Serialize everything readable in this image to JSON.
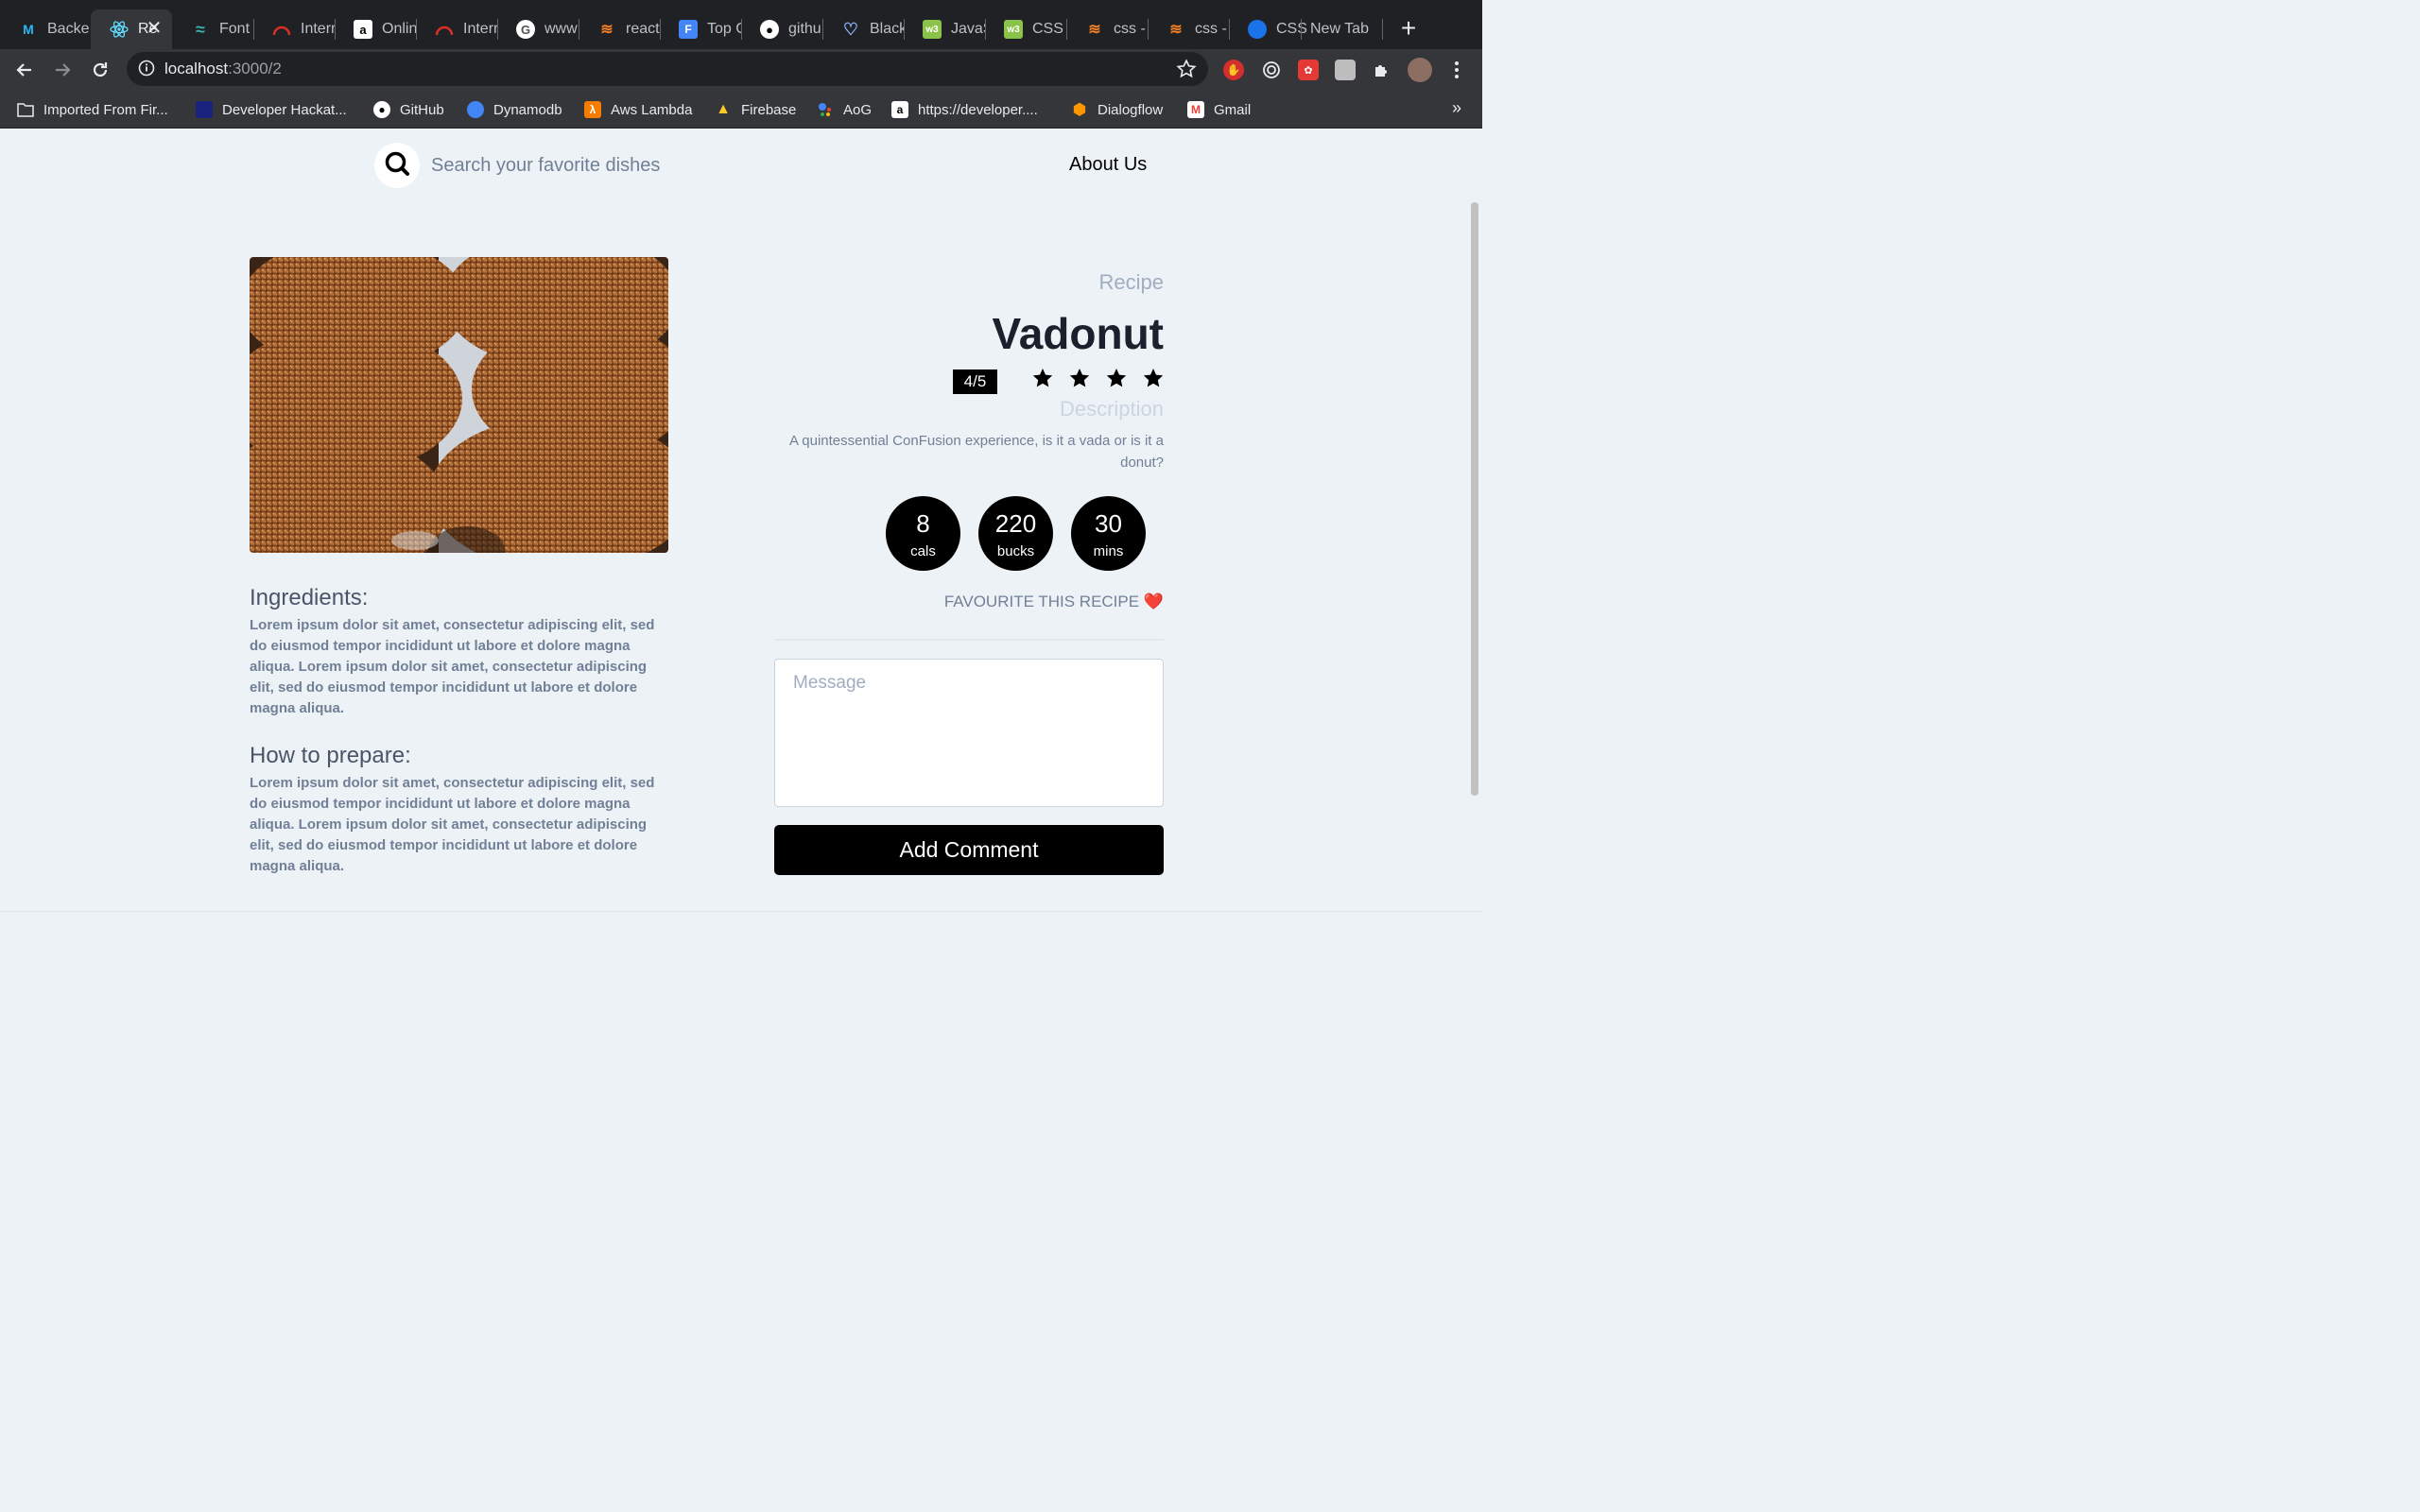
{
  "browser": {
    "tabs": [
      {
        "label": "Backe",
        "icon": "mui-icon",
        "color": "#29b6f6"
      },
      {
        "label": "Re",
        "icon": "react-icon",
        "color": "#61dafb",
        "active": true
      },
      {
        "label": "Font",
        "icon": "tailwind-icon",
        "color": "#38b2ac"
      },
      {
        "label": "Interr",
        "icon": "speedometer-icon",
        "color": "#d93025"
      },
      {
        "label": "Onlin",
        "icon": "amazon-icon",
        "color": "#ffffff"
      },
      {
        "label": "Interr",
        "icon": "speedometer-icon",
        "color": "#d93025"
      },
      {
        "label": "www",
        "icon": "google-icon",
        "color": "#ffffff"
      },
      {
        "label": "react",
        "icon": "stackoverflow-icon",
        "color": "#f48024"
      },
      {
        "label": "Top G",
        "icon": "forms-icon",
        "color": "#4285f4"
      },
      {
        "label": "githu",
        "icon": "github-icon",
        "color": "#ffffff"
      },
      {
        "label": "Black",
        "icon": "heart-outline-icon",
        "color": "#8ab4f8"
      },
      {
        "label": "JavaS",
        "icon": "w3schools-icon",
        "color": "#8bc34a"
      },
      {
        "label": "CSS",
        "icon": "w3schools-icon",
        "color": "#8bc34a"
      },
      {
        "label": "css -",
        "icon": "stackoverflow-icon",
        "color": "#f48024"
      },
      {
        "label": "css -",
        "icon": "stackoverflow-icon",
        "color": "#f48024"
      },
      {
        "label": "CSS",
        "icon": "globe-icon",
        "color": "#1a73e8"
      },
      {
        "label": "New Tab",
        "icon": "",
        "color": ""
      }
    ],
    "url_host": "localhost",
    "url_path": ":3000/2",
    "bookmarks": [
      {
        "label": "Imported From Fir...",
        "icon": "folder-icon",
        "color": "#e8eaed"
      },
      {
        "label": "Developer Hackat...",
        "icon": "hackathon-icon",
        "color": "#1a237e"
      },
      {
        "label": "GitHub",
        "icon": "github-icon",
        "color": "#ffffff"
      },
      {
        "label": "Dynamodb",
        "icon": "dynamodb-icon",
        "color": "#4285f4"
      },
      {
        "label": "Aws Lambda",
        "icon": "lambda-icon",
        "color": "#f57c00"
      },
      {
        "label": "Firebase",
        "icon": "firebase-icon",
        "color": "#ffca28"
      },
      {
        "label": "AoG",
        "icon": "assistant-icon",
        "color": "#4285f4"
      },
      {
        "label": "https://developer....",
        "icon": "amazon-icon",
        "color": "#ffffff"
      },
      {
        "label": "Dialogflow",
        "icon": "dialogflow-icon",
        "color": "#ff9800"
      },
      {
        "label": "Gmail",
        "icon": "gmail-icon",
        "color": "#ea4335"
      }
    ],
    "bookmarks_more": "»"
  },
  "header": {
    "search_placeholder": "Search your favorite dishes",
    "about_label": "About Us"
  },
  "recipe": {
    "label": "Recipe",
    "name": "Vadonut",
    "rating_text": "4/5",
    "rating_value": 4,
    "rating_max": 5,
    "description_title": "Description",
    "description": "A quintessential ConFusion experience, is it a vada or is it a donut?",
    "stats": [
      {
        "value": "8",
        "unit": "cals"
      },
      {
        "value": "220",
        "unit": "bucks"
      },
      {
        "value": "30",
        "unit": "mins"
      }
    ],
    "favourite_label": "FAVOURITE THIS RECIPE",
    "favourite_heart": "❤️",
    "ingredients_title": "Ingredients:",
    "ingredients_text": "Lorem ipsum dolor sit amet, consectetur adipiscing elit, sed do eiusmod tempor incididunt ut labore et dolore magna aliqua. Lorem ipsum dolor sit amet, consectetur adipiscing elit, sed do eiusmod tempor incididunt ut labore et dolore magna aliqua.",
    "prepare_title": "How to prepare:",
    "prepare_text": "Lorem ipsum dolor sit amet, consectetur adipiscing elit, sed do eiusmod tempor incididunt ut labore et dolore magna aliqua. Lorem ipsum dolor sit amet, consectetur adipiscing elit, sed do eiusmod tempor incididunt ut labore et dolore magna aliqua."
  },
  "comment": {
    "placeholder": "Message",
    "value": "",
    "button_label": "Add Comment"
  },
  "colors": {
    "page_bg": "#edf2f7",
    "accent": "#000000",
    "muted_text": "#718096",
    "heading": "#1a202c"
  }
}
